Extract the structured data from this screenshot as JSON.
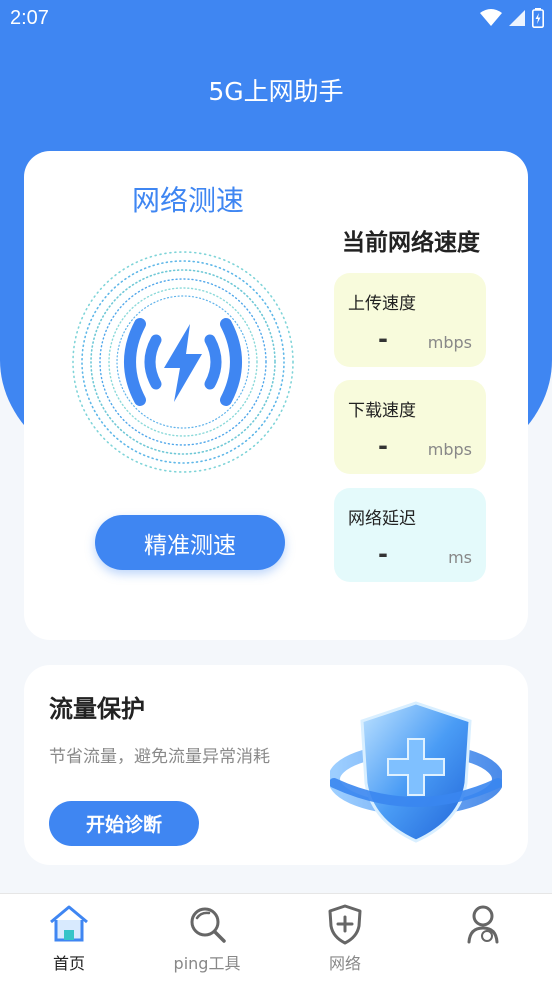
{
  "status": {
    "time": "2:07"
  },
  "app": {
    "title": "5G上网助手"
  },
  "speed_card": {
    "title": "网络测速",
    "current_title": "当前网络速度",
    "start_button": "精准测速",
    "metrics": [
      {
        "label": "上传速度",
        "value": "-",
        "unit": "mbps"
      },
      {
        "label": "下载速度",
        "value": "-",
        "unit": "mbps"
      },
      {
        "label": "网络延迟",
        "value": "-",
        "unit": "ms"
      }
    ]
  },
  "protect_card": {
    "title": "流量保护",
    "desc": "节省流量，避免流量异常消耗",
    "button": "开始诊断"
  },
  "tabs": [
    {
      "label": "首页",
      "icon": "home-icon",
      "active": true
    },
    {
      "label": "ping工具",
      "icon": "magnifier-icon",
      "active": false
    },
    {
      "label": "网络",
      "icon": "shield-plus-icon",
      "active": false
    },
    {
      "label": "",
      "icon": "user-icon",
      "active": false
    }
  ],
  "colors": {
    "primary": "#3f86f2",
    "upload_bg": "#f8fbdc",
    "latency_bg": "#e4fafb"
  }
}
